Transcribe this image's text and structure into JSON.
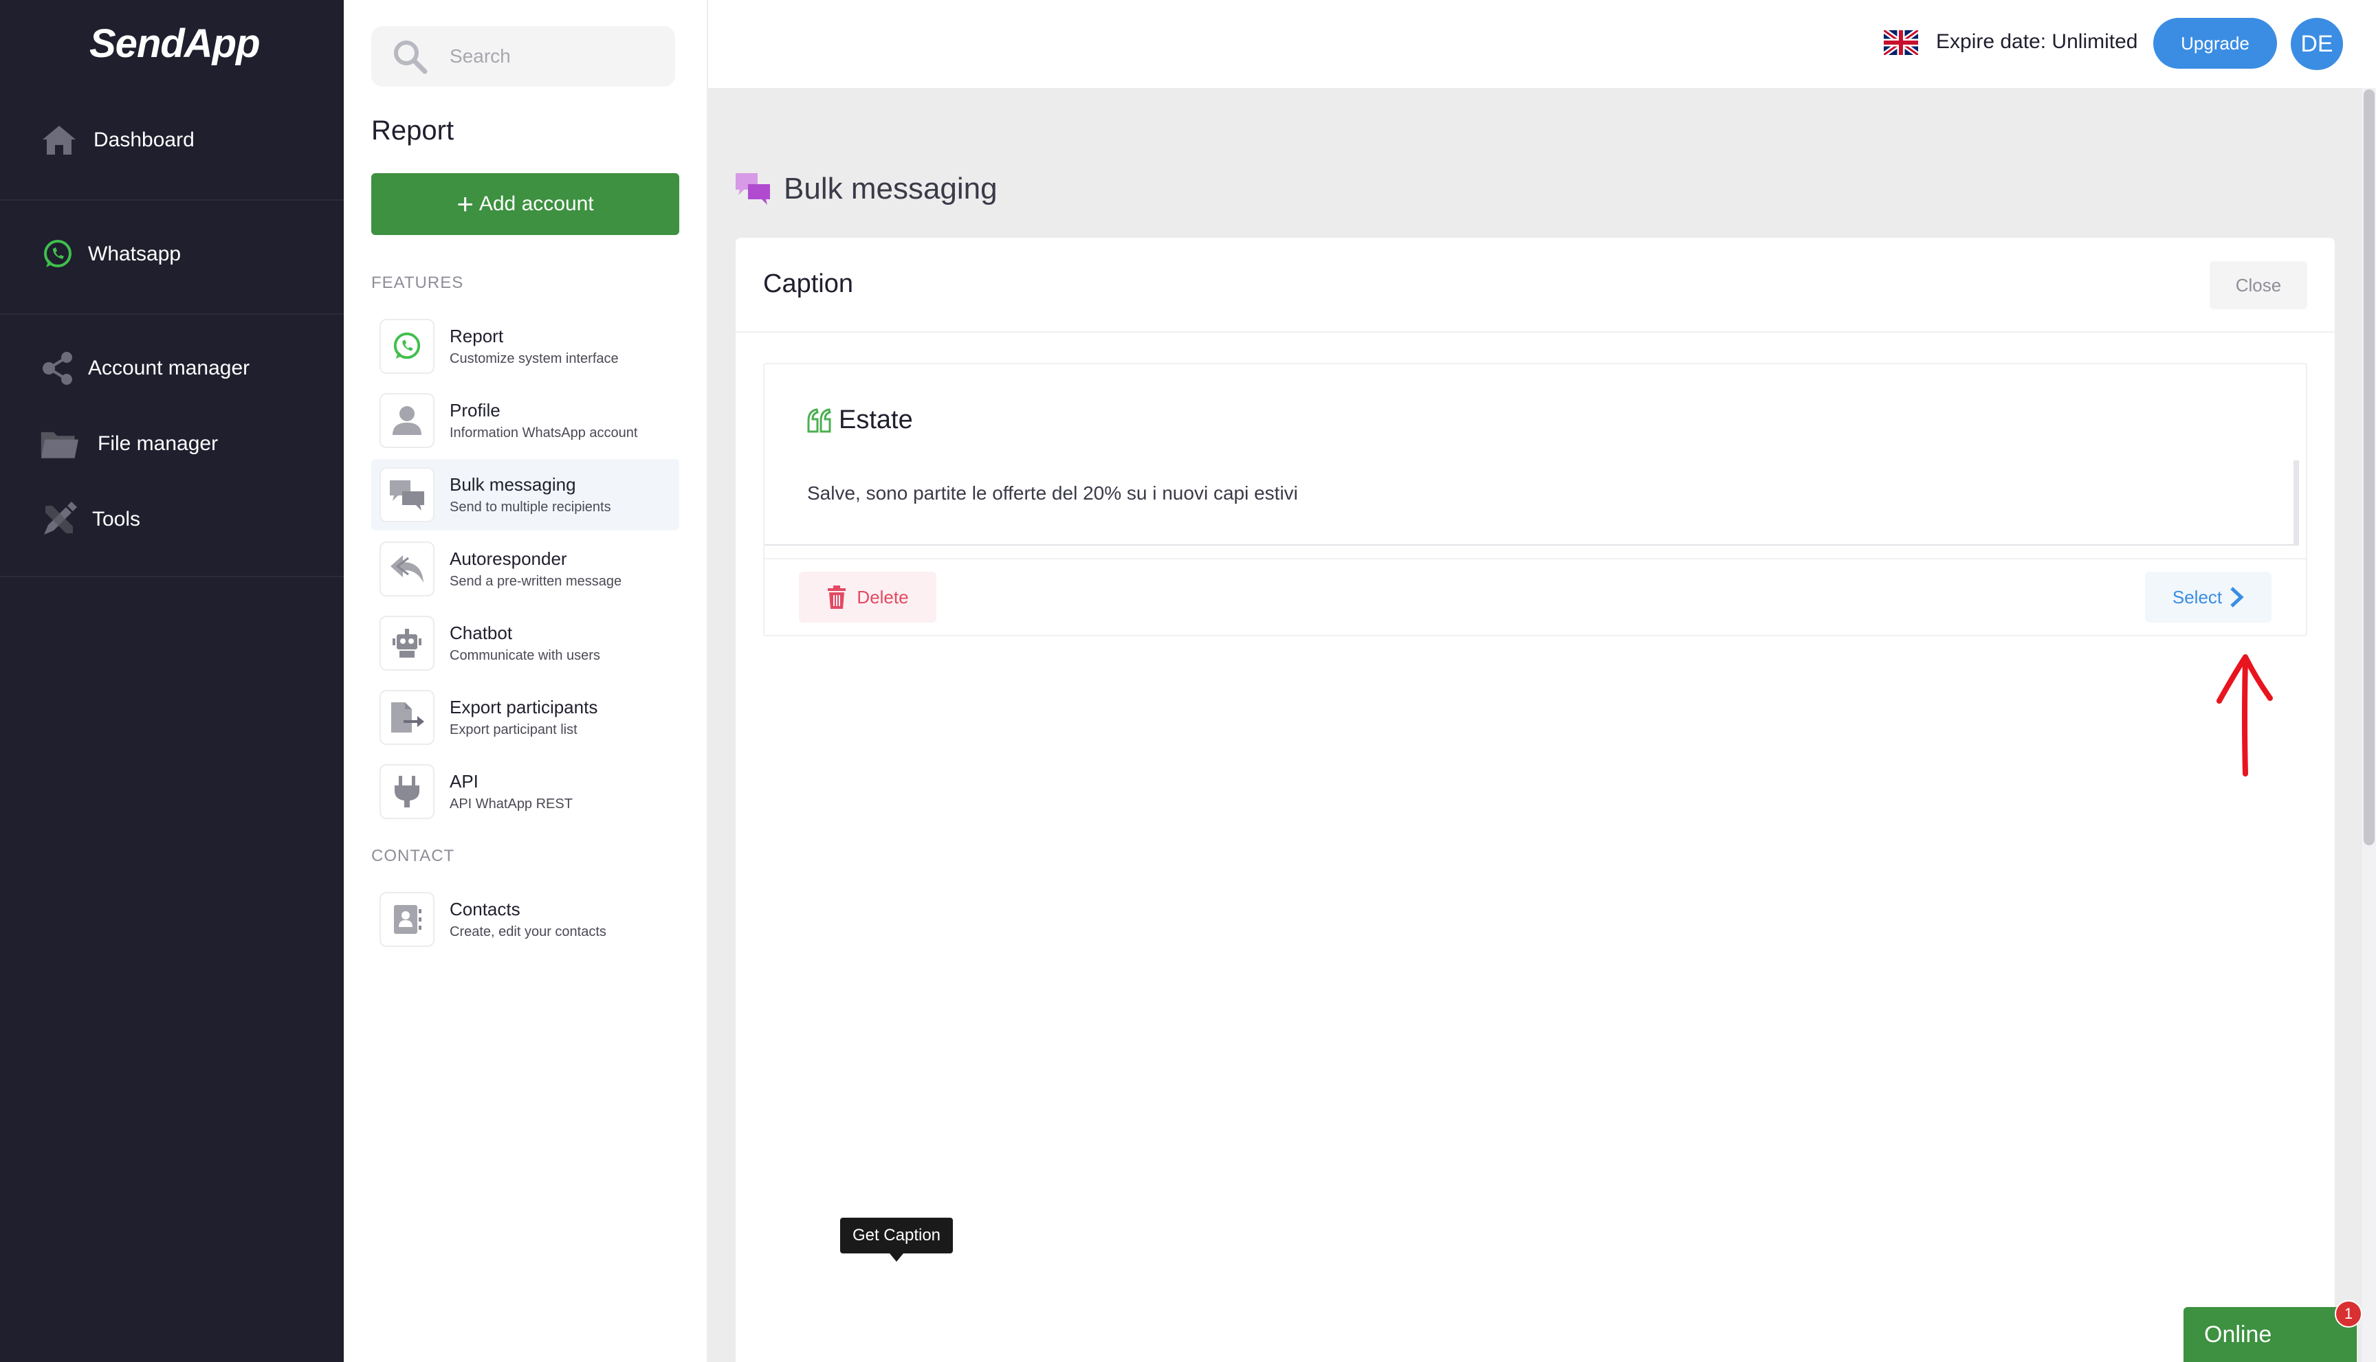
{
  "app": {
    "logo": "SendApp"
  },
  "nav": {
    "items": [
      {
        "label": "Dashboard",
        "icon": "home-icon"
      },
      {
        "label": "Whatsapp",
        "icon": "whatsapp-icon"
      },
      {
        "label": "Account manager",
        "icon": "share-icon"
      },
      {
        "label": "File manager",
        "icon": "folder-icon"
      },
      {
        "label": "Tools",
        "icon": "tools-icon"
      }
    ]
  },
  "panel": {
    "search_placeholder": "Search",
    "title": "Report",
    "add_button": "Add account",
    "features_label": "FEATURES",
    "features": [
      {
        "title": "Report",
        "subtitle": "Customize system interface",
        "icon": "whatsapp-icon"
      },
      {
        "title": "Profile",
        "subtitle": "Information WhatsApp account",
        "icon": "user-icon"
      },
      {
        "title": "Bulk messaging",
        "subtitle": "Send to multiple recipients",
        "icon": "chat-bubbles-icon",
        "active": true
      },
      {
        "title": "Autoresponder",
        "subtitle": "Send a pre-written message",
        "icon": "reply-icon"
      },
      {
        "title": "Chatbot",
        "subtitle": "Communicate with users",
        "icon": "robot-icon"
      },
      {
        "title": "Export participants",
        "subtitle": "Export participant list",
        "icon": "export-icon"
      },
      {
        "title": "API",
        "subtitle": "API WhatApp REST",
        "icon": "plug-icon"
      }
    ],
    "contact_label": "CONTACT",
    "contacts": [
      {
        "title": "Contacts",
        "subtitle": "Create, edit your contacts",
        "icon": "contact-book-icon"
      }
    ]
  },
  "header": {
    "expire": "Expire date: Unlimited",
    "upgrade": "Upgrade",
    "avatar": "DE"
  },
  "main": {
    "title": "Bulk messaging",
    "card": {
      "title": "Caption",
      "close": "Close",
      "caption": {
        "name": "Estate",
        "text": "Salve, sono partite le offerte del 20% su i nuovi capi estivi",
        "delete": "Delete",
        "select": "Select"
      }
    },
    "tooltip": "Get Caption"
  },
  "status": {
    "online": "Online",
    "badge": "1"
  },
  "colors": {
    "sidebar": "#1f1f2e",
    "green": "#3d9140",
    "blue": "#3a8de2",
    "red": "#e24a63"
  }
}
